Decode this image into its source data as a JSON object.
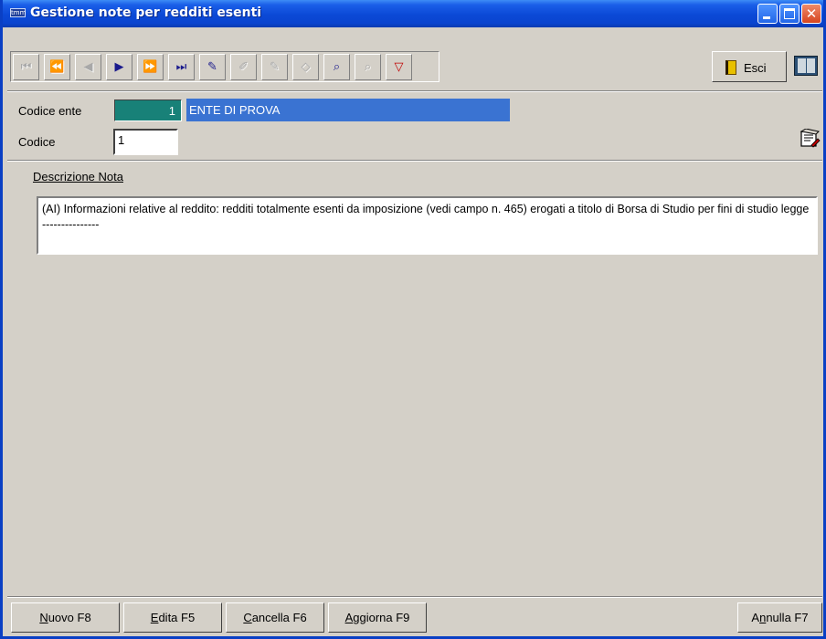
{
  "window": {
    "app_icon_text": "tmm",
    "title": "Gestione note per redditi esenti",
    "close_glyph": "✕"
  },
  "toolbar": {
    "buttons": [
      {
        "name": "first-record-button",
        "icon": "first-icon",
        "glyph": "⏮",
        "state": "disabled"
      },
      {
        "name": "fast-back-button",
        "icon": "rewind-icon",
        "glyph": "⏪",
        "state": "disabled"
      },
      {
        "name": "previous-record-button",
        "icon": "previous-icon",
        "glyph": "◀",
        "state": "disabled"
      },
      {
        "name": "next-record-button",
        "icon": "next-icon",
        "glyph": "▶",
        "state": "enabled"
      },
      {
        "name": "fast-forward-button",
        "icon": "fast-forward-icon",
        "glyph": "⏩",
        "state": "enabled"
      },
      {
        "name": "last-record-button",
        "icon": "last-icon",
        "glyph": "⏭",
        "state": "enabled"
      },
      {
        "name": "new-record-button",
        "icon": "pencil-plus-icon",
        "glyph": "✎",
        "state": "enabled"
      },
      {
        "name": "edit-record-button",
        "icon": "eraser-icon",
        "glyph": "✐",
        "state": "disabled"
      },
      {
        "name": "delete-record-button",
        "icon": "eraser-minus-icon",
        "glyph": "✎",
        "state": "disabled"
      },
      {
        "name": "clear-button",
        "icon": "eraser-icon",
        "glyph": "◇",
        "state": "disabled"
      },
      {
        "name": "search-button",
        "icon": "magnifier-icon",
        "glyph": "⌕",
        "state": "enabled"
      },
      {
        "name": "search-more-button",
        "icon": "magnifier-dots-icon",
        "glyph": "⌕",
        "state": "disabled"
      },
      {
        "name": "filter-button",
        "icon": "funnel-icon",
        "glyph": "▽",
        "state": "enabled"
      }
    ],
    "exit_label": "Esci",
    "exit_icon": "door-exit-icon",
    "help_icon": "book-icon"
  },
  "form": {
    "codice_ente_label": "Codice ente",
    "codice_ente_value": "1",
    "ente_name": "ENTE DI PROVA",
    "codice_label": "Codice",
    "codice_value": "1",
    "notepad_icon": "notepad-icon",
    "descrizione_label": "Descrizione Nota",
    "descrizione_text": "(AI) Informazioni relative al reddito: redditi totalmente esenti da imposizione (vedi campo n. 465) erogati a titolo di Borsa di Studio per fini di studio legge ---------------"
  },
  "footer": {
    "nuovo": {
      "u": "N",
      "rest": "uovo F8"
    },
    "edita": {
      "u": "E",
      "rest": "dita F5"
    },
    "cancella": {
      "u": "C",
      "rest": "ancella F6"
    },
    "aggiorna": {
      "u": "A",
      "rest": "ggiorna F9"
    },
    "annulla": {
      "pre": "A",
      "u": "n",
      "rest": "nulla F7"
    }
  },
  "colors": {
    "titlebar": "#0b49d6",
    "window_bg": "#d4d0c8",
    "ente_code_bg": "#188178",
    "ente_name_bg": "#3a73d2"
  }
}
